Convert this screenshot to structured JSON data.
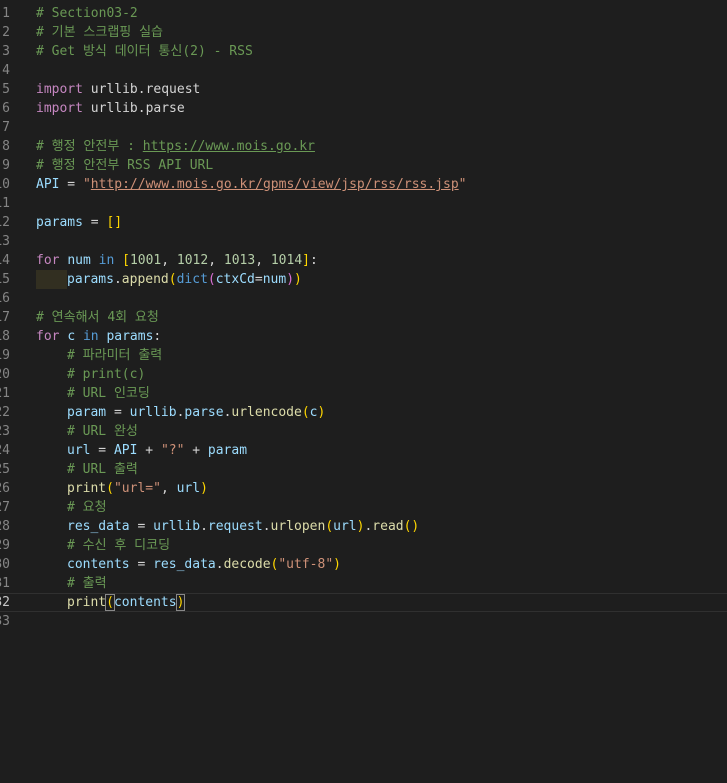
{
  "editor": {
    "language": "python",
    "current_line": 32,
    "lines": [
      {
        "n": "1",
        "tokens": [
          {
            "t": "# Section03-2",
            "c": "cmt"
          }
        ]
      },
      {
        "n": "2",
        "tokens": [
          {
            "t": "# 기본 스크랩핑 실습",
            "c": "cmt"
          }
        ]
      },
      {
        "n": "3",
        "tokens": [
          {
            "t": "# Get 방식 데이터 통신(2) - RSS",
            "c": "cmt"
          }
        ]
      },
      {
        "n": "4",
        "tokens": []
      },
      {
        "n": "5",
        "tokens": [
          {
            "t": "import",
            "c": "kw"
          },
          {
            "t": " urllib.request",
            "c": ""
          }
        ]
      },
      {
        "n": "6",
        "tokens": [
          {
            "t": "import",
            "c": "kw"
          },
          {
            "t": " urllib.parse",
            "c": ""
          }
        ]
      },
      {
        "n": "7",
        "tokens": []
      },
      {
        "n": "8",
        "tokens": [
          {
            "t": "# 행정 안전부 : ",
            "c": "cmt"
          },
          {
            "t": "https://www.mois.go.kr",
            "c": "cmt url"
          }
        ]
      },
      {
        "n": "9",
        "tokens": [
          {
            "t": "# 행정 안전부 RSS API URL",
            "c": "cmt"
          }
        ]
      },
      {
        "n": "10",
        "tokens": [
          {
            "t": "API",
            "c": "var"
          },
          {
            "t": " = ",
            "c": ""
          },
          {
            "t": "\"",
            "c": "str"
          },
          {
            "t": "http://www.mois.go.kr/gpms/view/jsp/rss/rss.jsp",
            "c": "str url"
          },
          {
            "t": "\"",
            "c": "str"
          }
        ]
      },
      {
        "n": "11",
        "tokens": []
      },
      {
        "n": "12",
        "tokens": [
          {
            "t": "params",
            "c": "var"
          },
          {
            "t": " = ",
            "c": ""
          },
          {
            "t": "[]",
            "c": "br"
          }
        ]
      },
      {
        "n": "13",
        "tokens": []
      },
      {
        "n": "14",
        "tokens": [
          {
            "t": "for",
            "c": "kw"
          },
          {
            "t": " ",
            "c": ""
          },
          {
            "t": "num",
            "c": "var"
          },
          {
            "t": " ",
            "c": ""
          },
          {
            "t": "in",
            "c": "kwb"
          },
          {
            "t": " ",
            "c": ""
          },
          {
            "t": "[",
            "c": "br"
          },
          {
            "t": "1001",
            "c": "num"
          },
          {
            "t": ", ",
            "c": ""
          },
          {
            "t": "1012",
            "c": "num"
          },
          {
            "t": ", ",
            "c": ""
          },
          {
            "t": "1013",
            "c": "num"
          },
          {
            "t": ", ",
            "c": ""
          },
          {
            "t": "1014",
            "c": "num"
          },
          {
            "t": "]",
            "c": "br"
          },
          {
            "t": ":",
            "c": ""
          }
        ]
      },
      {
        "n": "15",
        "indent": 1,
        "hl": true,
        "tokens": [
          {
            "t": "params",
            "c": "var"
          },
          {
            "t": ".",
            "c": ""
          },
          {
            "t": "append",
            "c": "fn"
          },
          {
            "t": "(",
            "c": "br"
          },
          {
            "t": "dict",
            "c": "kwb"
          },
          {
            "t": "(",
            "c": "br2"
          },
          {
            "t": "ctxCd",
            "c": "var"
          },
          {
            "t": "=",
            "c": ""
          },
          {
            "t": "num",
            "c": "var"
          },
          {
            "t": ")",
            "c": "br2"
          },
          {
            "t": ")",
            "c": "br"
          }
        ]
      },
      {
        "n": "16",
        "tokens": []
      },
      {
        "n": "17",
        "tokens": [
          {
            "t": "# 연속해서 4회 요청",
            "c": "cmt"
          }
        ]
      },
      {
        "n": "18",
        "tokens": [
          {
            "t": "for",
            "c": "kw"
          },
          {
            "t": " ",
            "c": ""
          },
          {
            "t": "c",
            "c": "var"
          },
          {
            "t": " ",
            "c": ""
          },
          {
            "t": "in",
            "c": "kwb"
          },
          {
            "t": " ",
            "c": ""
          },
          {
            "t": "params",
            "c": "var"
          },
          {
            "t": ":",
            "c": ""
          }
        ]
      },
      {
        "n": "19",
        "indent": 1,
        "tokens": [
          {
            "t": "# 파라미터 출력",
            "c": "cmt"
          }
        ]
      },
      {
        "n": "20",
        "indent": 1,
        "tokens": [
          {
            "t": "# print(c)",
            "c": "cmt"
          }
        ]
      },
      {
        "n": "21",
        "indent": 1,
        "tokens": [
          {
            "t": "# URL 인코딩",
            "c": "cmt"
          }
        ]
      },
      {
        "n": "22",
        "indent": 1,
        "tokens": [
          {
            "t": "param",
            "c": "var"
          },
          {
            "t": " = ",
            "c": ""
          },
          {
            "t": "urllib",
            "c": "var"
          },
          {
            "t": ".",
            "c": ""
          },
          {
            "t": "parse",
            "c": "var"
          },
          {
            "t": ".",
            "c": ""
          },
          {
            "t": "urlencode",
            "c": "fn"
          },
          {
            "t": "(",
            "c": "br"
          },
          {
            "t": "c",
            "c": "var"
          },
          {
            "t": ")",
            "c": "br"
          }
        ]
      },
      {
        "n": "23",
        "indent": 1,
        "tokens": [
          {
            "t": "# URL 완성",
            "c": "cmt"
          }
        ]
      },
      {
        "n": "24",
        "indent": 1,
        "tokens": [
          {
            "t": "url",
            "c": "var"
          },
          {
            "t": " = ",
            "c": ""
          },
          {
            "t": "API",
            "c": "var"
          },
          {
            "t": " + ",
            "c": ""
          },
          {
            "t": "\"?\"",
            "c": "str"
          },
          {
            "t": " + ",
            "c": ""
          },
          {
            "t": "param",
            "c": "var"
          }
        ]
      },
      {
        "n": "25",
        "indent": 1,
        "tokens": [
          {
            "t": "# URL 출력",
            "c": "cmt"
          }
        ]
      },
      {
        "n": "26",
        "indent": 1,
        "tokens": [
          {
            "t": "print",
            "c": "fn"
          },
          {
            "t": "(",
            "c": "br"
          },
          {
            "t": "\"url=\"",
            "c": "str"
          },
          {
            "t": ", ",
            "c": ""
          },
          {
            "t": "url",
            "c": "var"
          },
          {
            "t": ")",
            "c": "br"
          }
        ]
      },
      {
        "n": "27",
        "indent": 1,
        "tokens": [
          {
            "t": "# 요청",
            "c": "cmt"
          }
        ]
      },
      {
        "n": "28",
        "indent": 1,
        "tokens": [
          {
            "t": "res_data",
            "c": "var"
          },
          {
            "t": " = ",
            "c": ""
          },
          {
            "t": "urllib",
            "c": "var"
          },
          {
            "t": ".",
            "c": ""
          },
          {
            "t": "request",
            "c": "var"
          },
          {
            "t": ".",
            "c": ""
          },
          {
            "t": "urlopen",
            "c": "fn"
          },
          {
            "t": "(",
            "c": "br"
          },
          {
            "t": "url",
            "c": "var"
          },
          {
            "t": ")",
            "c": "br"
          },
          {
            "t": ".",
            "c": ""
          },
          {
            "t": "read",
            "c": "fn"
          },
          {
            "t": "()",
            "c": "br"
          }
        ]
      },
      {
        "n": "29",
        "indent": 1,
        "tokens": [
          {
            "t": "# 수신 후 디코딩",
            "c": "cmt"
          }
        ]
      },
      {
        "n": "30",
        "indent": 1,
        "tokens": [
          {
            "t": "contents",
            "c": "var"
          },
          {
            "t": " = ",
            "c": ""
          },
          {
            "t": "res_data",
            "c": "var"
          },
          {
            "t": ".",
            "c": ""
          },
          {
            "t": "decode",
            "c": "fn"
          },
          {
            "t": "(",
            "c": "br"
          },
          {
            "t": "\"utf-8\"",
            "c": "str"
          },
          {
            "t": ")",
            "c": "br"
          }
        ]
      },
      {
        "n": "31",
        "indent": 1,
        "tokens": [
          {
            "t": "# 출력",
            "c": "cmt"
          }
        ]
      },
      {
        "n": "32",
        "indent": 1,
        "tokens": [
          {
            "t": "print",
            "c": "fn"
          },
          {
            "t": "(",
            "c": "br bracket-match"
          },
          {
            "t": "contents",
            "c": "var"
          },
          {
            "t": ")",
            "c": "br bracket-match"
          }
        ]
      },
      {
        "n": "33",
        "tokens": []
      }
    ]
  }
}
